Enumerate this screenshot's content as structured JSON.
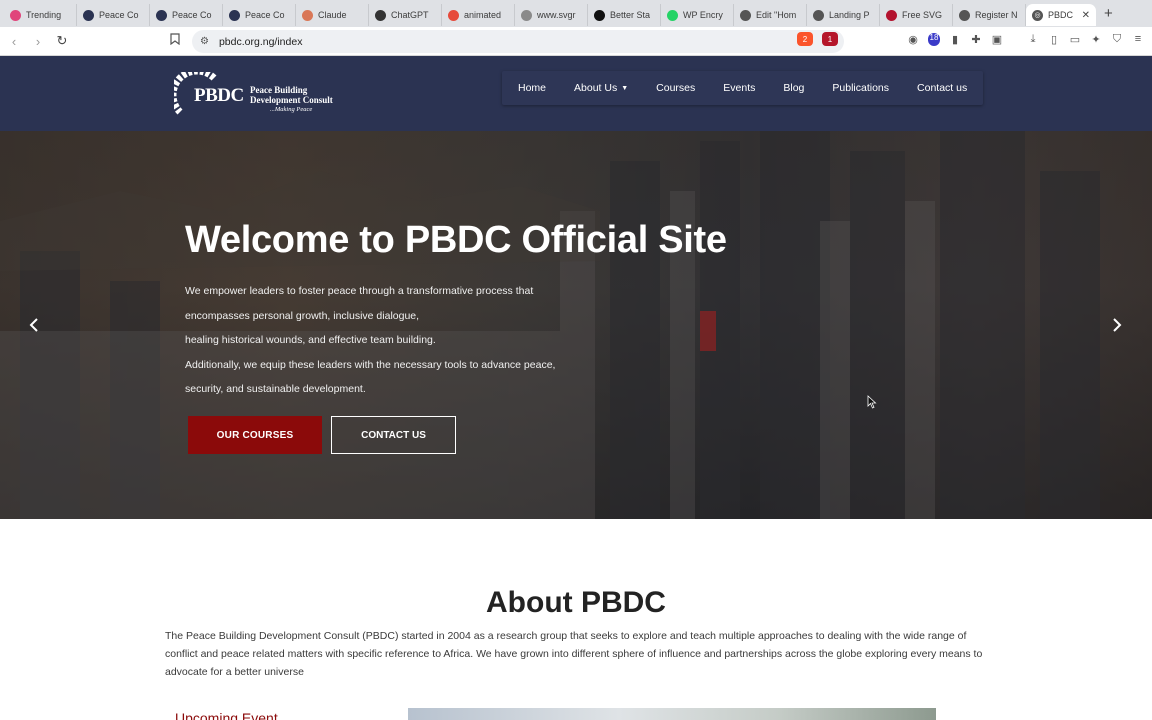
{
  "browser": {
    "tabs": [
      {
        "title": "Trending",
        "color": "#e0457b"
      },
      {
        "title": "Peace Co",
        "color": "#2b3352"
      },
      {
        "title": "Peace Co",
        "color": "#2b3352"
      },
      {
        "title": "Peace Co",
        "color": "#2b3352"
      },
      {
        "title": "Claude",
        "color": "#d97757"
      },
      {
        "title": "ChatGPT",
        "color": "#333333"
      },
      {
        "title": "animated",
        "color": "#e64a3b"
      },
      {
        "title": "www.svgr",
        "color": "#8a8a8a"
      },
      {
        "title": "Better Sta",
        "color": "#111111"
      },
      {
        "title": "WP Encry",
        "color": "#25d366"
      },
      {
        "title": "Edit \"Hom",
        "color": "#555555"
      },
      {
        "title": "Landing P",
        "color": "#555555"
      },
      {
        "title": "Free SVG",
        "color": "#b3122e"
      },
      {
        "title": "Register N",
        "color": "#555555"
      }
    ],
    "active_tab": {
      "title": "PBDC",
      "color": "#555555"
    },
    "url": "pbdc.org.ng/index",
    "brave_count": "2",
    "alert_count": "1",
    "ext_count": "18"
  },
  "header": {
    "logo": {
      "mark": "PBDC",
      "line1": "Peace Building",
      "line2": "Development Consult",
      "tagline": "...Making Peace"
    },
    "nav": [
      {
        "label": "Home"
      },
      {
        "label": "About Us",
        "has_dropdown": true
      },
      {
        "label": "Courses"
      },
      {
        "label": "Events"
      },
      {
        "label": "Blog"
      },
      {
        "label": "Publications"
      },
      {
        "label": "Contact us"
      }
    ]
  },
  "hero": {
    "title": "Welcome to PBDC Official Site",
    "lines": [
      "We empower leaders to foster peace through a transformative process that",
      "encompasses personal growth, inclusive dialogue,",
      "healing historical wounds, and effective team building.",
      "Additionally, we equip these leaders with the necessary tools to advance peace,",
      "security, and sustainable development."
    ],
    "primary_button": "OUR COURSES",
    "secondary_button": "CONTACT US",
    "accent_color": "#8b0a0a"
  },
  "about": {
    "title": "About PBDC",
    "text": "The Peace Building Development Consult (PBDC) started in 2004 as a research group that seeks to explore and teach multiple approaches to dealing with the wide range of conflict and peace related matters with specific reference to Africa. We have grown into different sphere of influence and partnerships across the globe exploring every means to advocate for a better universe",
    "upcoming_label": "Upcoming Event"
  }
}
